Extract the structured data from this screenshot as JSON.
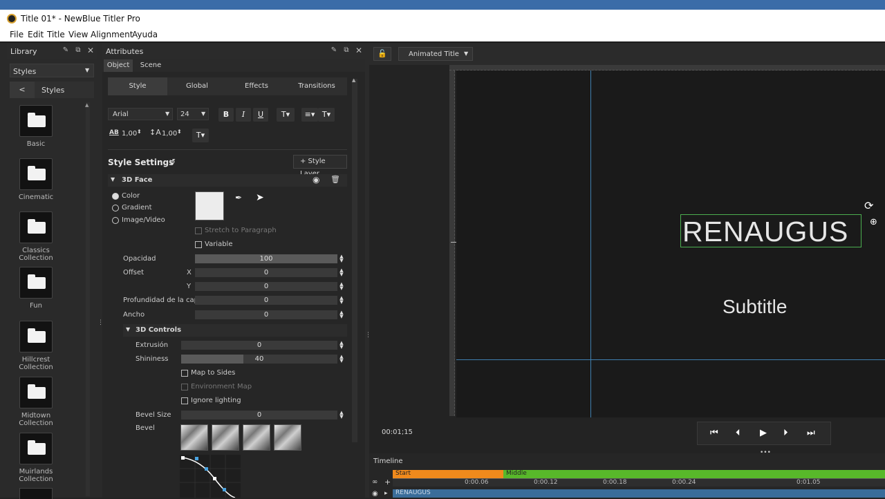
{
  "window": {
    "title": "Title 01* - NewBlue Titler Pro"
  },
  "menu": [
    "File",
    "Edit",
    "Title",
    "View",
    "Alignment",
    "Ayuda"
  ],
  "library": {
    "title": "Library",
    "dropdown": "Styles",
    "back": "<",
    "breadcrumb": "Styles",
    "folders": [
      "Basic",
      "Cinematic",
      "Classics Collection",
      "Fun",
      "Hillcrest Collection",
      "Midtown Collection",
      "Muirlands Collection"
    ]
  },
  "attributes": {
    "title": "Attributes",
    "top_tabs": [
      "Object",
      "Scene"
    ],
    "sub_tabs": [
      "Style",
      "Global",
      "Effects",
      "Transitions"
    ],
    "font": "Arial",
    "size": "24",
    "bold": "B",
    "italic": "I",
    "underline": "U",
    "tracking_label": "AB",
    "tracking": "1,00",
    "leading": "1,00",
    "style_settings": "Style Settings",
    "style_layer": "+ Style Layer",
    "face_section": "3D Face",
    "fill_options": [
      "Color",
      "Gradient",
      "Image/Video"
    ],
    "stretch": "Stretch to Paragraph",
    "variable": "Variable",
    "opacity": {
      "label": "Opacidad",
      "value": "100"
    },
    "offset": {
      "label": "Offset",
      "x_label": "X",
      "x": "0",
      "y_label": "Y",
      "y": "0"
    },
    "depth": {
      "label": "Profundidad de la capa",
      "value": "0"
    },
    "width": {
      "label": "Ancho",
      "value": "0"
    },
    "controls_section": "3D Controls",
    "extrusion": {
      "label": "Extrusión",
      "value": "0"
    },
    "shininess": {
      "label": "Shininess",
      "value": "40",
      "fraction": 0.4
    },
    "map_to_sides": "Map to Sides",
    "environment_map": "Environment Map",
    "ignore_lighting": "Ignore lighting",
    "bevel_size": {
      "label": "Bevel Size",
      "value": "0"
    },
    "bevel": "Bevel"
  },
  "preview": {
    "mode": "Animated Title",
    "title_text": "RENAUGUS",
    "subtitle_text": "Subtitle",
    "timecode": "00:01;15"
  },
  "timeline": {
    "title": "Timeline",
    "start": "Start",
    "middle": "Middle",
    "ticks": [
      "0:00.06",
      "0:00.12",
      "0:00.18",
      "0:00.24",
      "0:01.05"
    ],
    "track": "RENAUGUS"
  },
  "colors": {
    "start_bar": "#f08a1c",
    "middle_bar": "#58b82a",
    "guide": "#3f7fb0",
    "selection": "#4caf50"
  }
}
